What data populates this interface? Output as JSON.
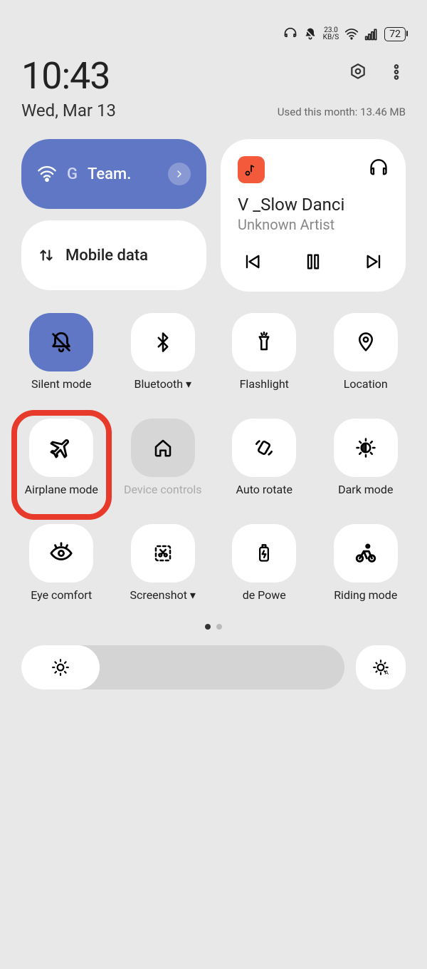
{
  "status": {
    "speed": "23.0",
    "speed_unit": "KB/S",
    "battery": "72"
  },
  "time": "10:43",
  "date": "Wed, Mar 13",
  "usage": "Used this month: 13.46 MB",
  "wifi": {
    "prefix": "G",
    "name": "Team."
  },
  "mobile_data": {
    "label": "Mobile data"
  },
  "media": {
    "title": "V _Slow Danci",
    "artist": "Unknown Artist"
  },
  "tiles": {
    "silent": "Silent mode",
    "bluetooth": "Bluetooth ▾",
    "flashlight": "Flashlight",
    "location": "Location",
    "airplane": "Airplane mode",
    "device": "Device controls",
    "autorotate": "Auto rotate",
    "darkmode": "Dark mode",
    "eyecomfort": "Eye comfort",
    "screenshot": "Screenshot ▾",
    "power": "de     Powe",
    "riding": "Riding mode"
  }
}
